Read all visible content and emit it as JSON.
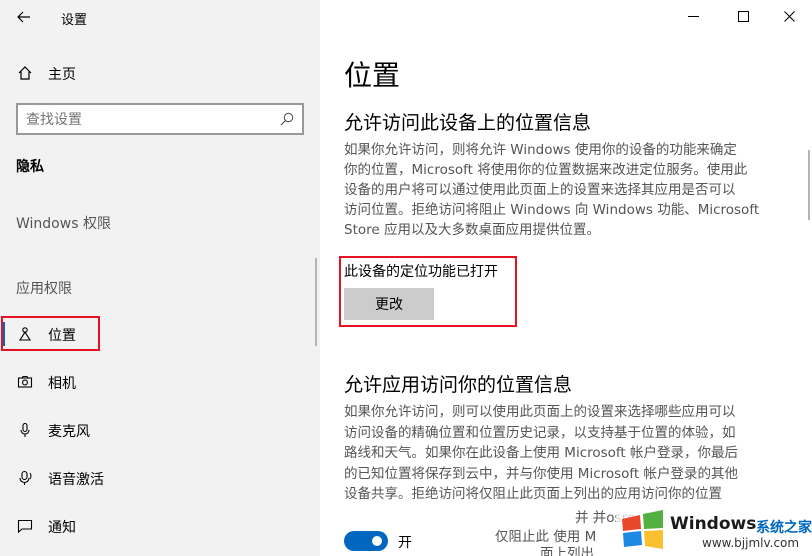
{
  "window": {
    "title": "设置"
  },
  "sidebar": {
    "home": "主页",
    "search": {
      "placeholder": "查找设置"
    },
    "section": "隐私",
    "windows_permissions": "Windows 权限",
    "app_permissions": "应用权限",
    "items": [
      {
        "label": "位置"
      },
      {
        "label": "相机"
      },
      {
        "label": "麦克风"
      },
      {
        "label": "语音激活"
      },
      {
        "label": "通知"
      }
    ]
  },
  "main": {
    "title": "位置",
    "device_heading": "允许访问此设备上的位置信息",
    "device_desc": [
      "如果你允许访问，则将允许 Windows 使用你的设备的功能来确定",
      "你的位置，Microsoft 将使用你的位置数据来改进定位服务。使用此",
      "设备的用户将可以通过使用此页面上的设置来选择其应用是否可以",
      "访问位置。拒绝访问将阻止 Windows 向 Windows 功能、Microsoft",
      "Store 应用以及大多数桌面应用提供位置。"
    ],
    "device_status": "此设备的定位功能已打开",
    "change_button": "更改",
    "apps_heading": "允许应用访问你的位置信息",
    "apps_desc": [
      "如果你允许访问，则可以使用此页面上的设置来选择哪些应用可以",
      "访问设备的精确位置和位置历史记录，以支持基于位置的体验，如",
      "路线和天气。如果你在此设备上使用 Microsoft 帐户登录，你最后",
      "的已知位置将保存到云中，并与你使用 Microsoft 帐户登录的其他",
      "设备共享。拒绝访问将仅阻止此页面上列出的应用访问你的位置"
    ],
    "toggle_label": "开",
    "toggle_on": true,
    "frag1": "并 并osro",
    "frag2": "仅阻止此 使用 M",
    "frag3": "面上列出"
  },
  "watermark": {
    "brand": "Windows",
    "site_cn": "系统之家",
    "url": "www.bjjmlv.com"
  },
  "colors": {
    "accent": "#0067c0",
    "highlight": "#e81123",
    "sidebar_bg": "#f2f2f2"
  }
}
